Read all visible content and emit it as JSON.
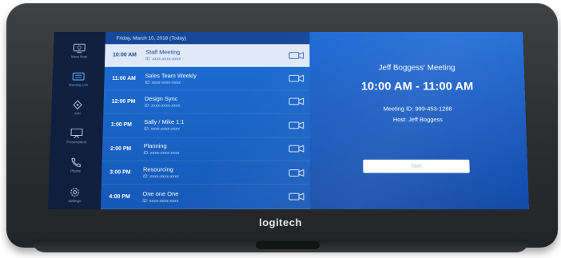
{
  "device": {
    "brand": "logitech"
  },
  "sidebar": {
    "items": [
      {
        "label": "Meet Now",
        "icon": "meet-now-icon",
        "active": false
      },
      {
        "label": "Meeting List",
        "icon": "meeting-list-icon",
        "active": true
      },
      {
        "label": "Join",
        "icon": "join-icon",
        "active": false
      },
      {
        "label": "Presentation",
        "icon": "presentation-icon",
        "active": false
      },
      {
        "label": "Phone",
        "icon": "phone-icon",
        "active": false
      },
      {
        "label": "Settings",
        "icon": "settings-icon",
        "active": false
      }
    ]
  },
  "schedule": {
    "date": "Friday, March 10, 2018 (Today)",
    "meetings": [
      {
        "time": "10:00 AM",
        "title": "Staff Meeting",
        "id_text": "ID: xxxx-xxxx-xxxx",
        "selected": true
      },
      {
        "time": "11:00 AM",
        "title": "Sales Team Weekly",
        "id_text": "ID: xxxx-xxxx-xxxx",
        "selected": false
      },
      {
        "time": "12:00 PM",
        "title": "Design Sync",
        "id_text": "ID: xxxx-xxxx-xxxx",
        "selected": false
      },
      {
        "time": "1:00 PM",
        "title": "Sally / Mike 1:1",
        "id_text": "ID: xxxx-xxxx-xxxx",
        "selected": false
      },
      {
        "time": "2:00 PM",
        "title": "Planning",
        "id_text": "ID: xxxx-xxxx-xxxx",
        "selected": false
      },
      {
        "time": "3:00 PM",
        "title": "Resourcing",
        "id_text": "ID: xxxx-xxxx-xxxx",
        "selected": false
      },
      {
        "time": "4:00 PM",
        "title": "One one One",
        "id_text": "ID: xxxx-xxxx-xxxx",
        "selected": false
      }
    ]
  },
  "detail": {
    "title": "Jeff Boggess' Meeting",
    "time_range": "10:00 AM - 11:00 AM",
    "meeting_id": "Meeting ID: 999-453-1288",
    "host": "Host: Jeff Boggess",
    "start_label": "Start"
  },
  "colors": {
    "sidebar_bg": "#0f1f3d",
    "list_bg": "#1e6fd6",
    "selected_row_bg": "#dfe9f7",
    "detail_bg": "#1f6ad6"
  }
}
